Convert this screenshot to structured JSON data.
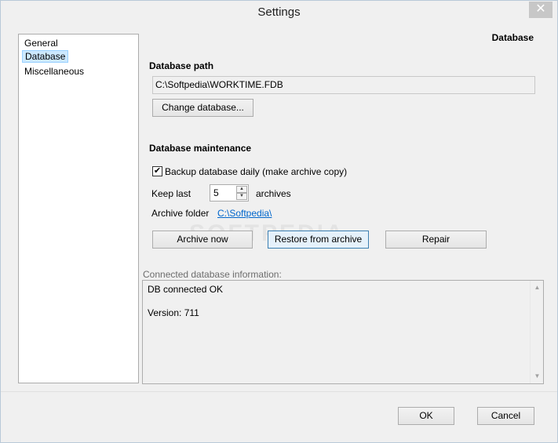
{
  "window": {
    "title": "Settings",
    "close_glyph": "✕"
  },
  "sidebar": {
    "items": [
      {
        "label": "General"
      },
      {
        "label": "Database"
      },
      {
        "label": "Miscellaneous"
      }
    ]
  },
  "page": {
    "title": "Database",
    "db_path": {
      "heading": "Database path",
      "value": "C:\\Softpedia\\WORKTIME.FDB",
      "change_button": "Change database..."
    },
    "maintenance": {
      "heading": "Database maintenance",
      "backup_checkbox_label": "Backup database daily (make archive copy)",
      "backup_checked": true,
      "keep_last_label": "Keep last",
      "keep_last_value": "5",
      "archives_label": "archives",
      "archive_folder_label": "Archive folder",
      "archive_folder_link": "C:\\Softpedia\\",
      "archive_now_button": "Archive now",
      "restore_button": "Restore from archive",
      "repair_button": "Repair"
    },
    "info": {
      "label": "Connected database information:",
      "lines": [
        "DB connected OK",
        "Version: 711"
      ]
    }
  },
  "footer": {
    "ok_button": "OK",
    "cancel_button": "Cancel"
  },
  "watermark": "SOFTPEDIA",
  "icons": {
    "check": "✔",
    "spin_up": "▲",
    "spin_down": "▼",
    "close": "close-icon"
  }
}
